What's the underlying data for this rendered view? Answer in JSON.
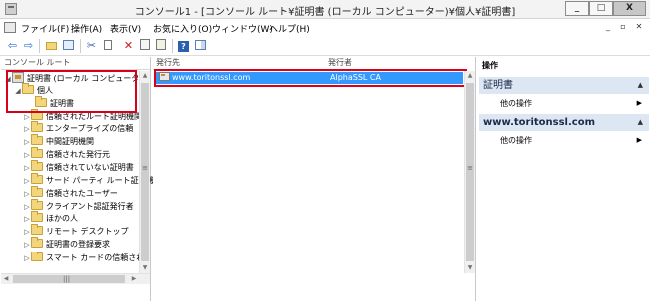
{
  "window": {
    "title": "コンソール1 - [コンソール ルート¥証明書 (ローカル コンピューター)¥個人¥証明書]",
    "controls": {
      "minimize": "_",
      "maximize": "□",
      "close": "X"
    }
  },
  "menubar": {
    "items": [
      "ファイル(F)",
      "操作(A)",
      "表示(V)",
      "お気に入り(O)",
      "ウィンドウ(W)",
      "ヘルプ(H)"
    ],
    "mdi_controls": {
      "minimize": "_",
      "restore": "▫",
      "close": "✕"
    }
  },
  "toolbar": {
    "buttons": [
      "back-icon",
      "forward-icon",
      "up-folder-icon",
      "show-tree-icon",
      "cut-icon",
      "copy-icon",
      "delete-icon",
      "properties-icon",
      "export-icon",
      "help-icon",
      "action-pane-icon"
    ]
  },
  "tree": {
    "header": "コンソール ルート",
    "nodes": [
      {
        "label": "証明書 (ローカル コンピューター)",
        "level": 0,
        "expander": "◢",
        "icon": "cert-store-icon"
      },
      {
        "label": "個人",
        "level": 1,
        "expander": "◢",
        "icon": "folder-open-icon"
      },
      {
        "label": "証明書",
        "level": 2,
        "expander": "",
        "icon": "folder-icon"
      },
      {
        "label": "信頼されたルート証明機関",
        "level": 1,
        "expander": "▷",
        "icon": "folder-icon"
      },
      {
        "label": "エンタープライズの信頼",
        "level": 1,
        "expander": "▷",
        "icon": "folder-icon"
      },
      {
        "label": "中間証明機関",
        "level": 1,
        "expander": "▷",
        "icon": "folder-icon"
      },
      {
        "label": "信頼された発行元",
        "level": 1,
        "expander": "▷",
        "icon": "folder-icon"
      },
      {
        "label": "信頼されていない証明書",
        "level": 1,
        "expander": "▷",
        "icon": "folder-icon"
      },
      {
        "label": "サード パーティ ルート証明機関",
        "level": 1,
        "expander": "▷",
        "icon": "folder-icon"
      },
      {
        "label": "信頼されたユーザー",
        "level": 1,
        "expander": "▷",
        "icon": "folder-icon"
      },
      {
        "label": "クライアント認証発行者",
        "level": 1,
        "expander": "▷",
        "icon": "folder-icon"
      },
      {
        "label": "ほかの人",
        "level": 1,
        "expander": "▷",
        "icon": "folder-icon"
      },
      {
        "label": "リモート デスクトップ",
        "level": 1,
        "expander": "▷",
        "icon": "folder-icon"
      },
      {
        "label": "証明書の登録要求",
        "level": 1,
        "expander": "▷",
        "icon": "folder-icon"
      },
      {
        "label": "スマート カードの信頼されたルート",
        "level": 1,
        "expander": "▷",
        "icon": "folder-icon"
      }
    ],
    "scroll_grip": "≡"
  },
  "list": {
    "columns": [
      "発行先",
      "発行者"
    ],
    "rows": [
      {
        "issued_to": "www.toritonssl.com",
        "issued_by": "AlphaSSL CA"
      }
    ],
    "scroll_grip": "≡"
  },
  "actions": {
    "header": "操作",
    "sections": [
      {
        "title": "証明書",
        "caret": "▲",
        "items": [
          {
            "label": "他の操作",
            "arrow": "▶"
          }
        ]
      },
      {
        "title": "www.toritonssl.com",
        "caret": "▲",
        "items": [
          {
            "label": "他の操作",
            "arrow": "▶"
          }
        ]
      }
    ]
  },
  "colors": {
    "selection": "#3399ff",
    "highlight_box": "#d9001b",
    "action_section_bg": "#dde6f3"
  }
}
